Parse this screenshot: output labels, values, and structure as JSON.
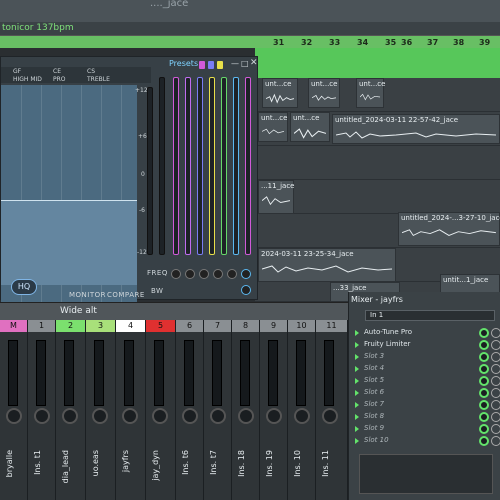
{
  "playlist": {
    "top_title": "...._jace",
    "tempo_tag": "tonicor 137bpm",
    "bar_numbers": [
      "31",
      "32",
      "33",
      "34",
      "35",
      "36",
      "37",
      "38",
      "39"
    ],
    "clips": [
      {
        "label": "unt...ce"
      },
      {
        "label": "unt...ce"
      },
      {
        "label": "unt...ce"
      },
      {
        "label": "unt...ce"
      },
      {
        "label": "unt...ce"
      },
      {
        "label": "untitled_2024-03-11 22-57-42_jace"
      },
      {
        "label": "...11_jace"
      },
      {
        "label": "untitled_2024-...3-27-10_jace"
      },
      {
        "label": "2024-03-11 23-25-34_jace"
      },
      {
        "label": "...33_jace"
      },
      {
        "label": "untit...1_jace"
      }
    ]
  },
  "eq": {
    "bands": [
      "GF",
      "CE",
      "CS",
      "HIGH MID",
      "PRO",
      "TREBLE"
    ],
    "presets_label": "Presets",
    "scale": [
      "+12",
      "+6",
      "0",
      "-6",
      "-12"
    ],
    "freq_label": "FREQ",
    "bw_label": "BW",
    "hq_label": "HQ",
    "monitor_label": "MONITOR",
    "compare_label": "COMPARE",
    "preset_colors": [
      "#d15ad9",
      "#c06cf0",
      "#7a7cf5",
      "#e8e04a",
      "#66d86a",
      "#5bb8f0",
      "#cf5ad8"
    ]
  },
  "mixer": {
    "bar_title": "Wide alt",
    "strips": [
      {
        "num": "M",
        "name": "bryalle",
        "color": "#e070c0"
      },
      {
        "num": "1",
        "name": "Ins. t1",
        "color": "#8a8f93"
      },
      {
        "num": "2",
        "name": "dia_lead",
        "color": "#7be06e"
      },
      {
        "num": "3",
        "name": "uo.eas",
        "color": "#a8e07a"
      },
      {
        "num": "4",
        "name": "jayfrs",
        "color": "#ffffff"
      },
      {
        "num": "5",
        "name": "jay_dyn",
        "color": "#e03030"
      },
      {
        "num": "6",
        "name": "Ins. t6",
        "color": "#8a8f93"
      },
      {
        "num": "7",
        "name": "Ins. t7",
        "color": "#8a8f93"
      },
      {
        "num": "8",
        "name": "Ins. 18",
        "color": "#8a8f93"
      },
      {
        "num": "9",
        "name": "Ins. 19",
        "color": "#8a8f93"
      },
      {
        "num": "10",
        "name": "Ins. 10",
        "color": "#8a8f93"
      },
      {
        "num": "11",
        "name": "Ins. 11",
        "color": "#8a8f93"
      }
    ]
  },
  "mixer_panel": {
    "title": "Mixer - jayfrs",
    "insert": "In 1",
    "slots": [
      {
        "label": "Auto-Tune Pro",
        "active": true
      },
      {
        "label": "Fruity Limiter",
        "active": true
      },
      {
        "label": "Slot 3",
        "active": false
      },
      {
        "label": "Slot 4",
        "active": false
      },
      {
        "label": "Slot 5",
        "active": false
      },
      {
        "label": "Slot 6",
        "active": false
      },
      {
        "label": "Slot 7",
        "active": false
      },
      {
        "label": "Slot 8",
        "active": false
      },
      {
        "label": "Slot 9",
        "active": false
      },
      {
        "label": "Slot 10",
        "active": false
      }
    ]
  }
}
